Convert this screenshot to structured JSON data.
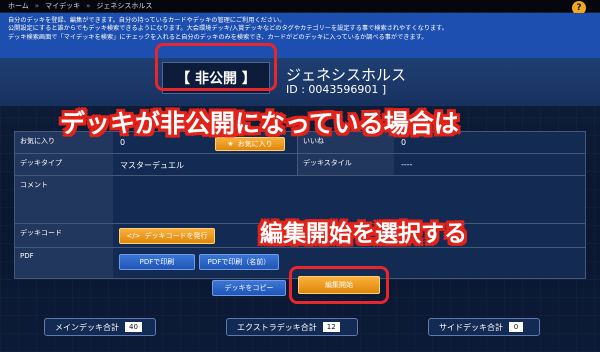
{
  "breadcrumb": [
    "ホーム",
    "マイデッキ",
    "ジェネシスホルス"
  ],
  "breadcrumb_sep": "»",
  "help_icon": "?",
  "intro_lines": [
    "自分のデッキを登録、編集ができます。自分の持っているカードやデッキの管理にご利用ください。",
    "公開設定にすると誰からでもデッキ検索できるようになります。大会環境デッキ/入賞デッキなどのタグやカテゴリーを設定する事で検索されやすくなります。",
    "デッキ検索画面で「マイデッキを検索」にチェックを入れると自分のデッキのみを検索でき、カードがどのデッキに入っているか調べる事ができます。"
  ],
  "deck": {
    "status": "【 非公開 】",
    "name": "ジェネシスホルス",
    "id_label": "ID : 0043596901 ]"
  },
  "annotations": {
    "first": "デッキが非公開になっている場合は",
    "second": "編集開始を選択する"
  },
  "details": {
    "favorite_label": "お気に入り",
    "favorite_value": "0",
    "favorite_button": "お気に入り",
    "views_label": "いいね",
    "views_value": "0",
    "type_label": "デッキタイプ",
    "type_value": "マスターデュエル",
    "style_label": "デッキスタイル",
    "style_value": "----",
    "comment_label": "コメント",
    "comment_value": "",
    "code_label": "デッキコード",
    "code_button": "デッキコードを発行",
    "pdf_label": "PDF",
    "pdf_button_1": "PDFで印刷",
    "pdf_button_2": "PDFで印刷（名前）"
  },
  "actions": {
    "copy": "デッキをコピー",
    "edit": "編集開始"
  },
  "summary": [
    {
      "label": "メインデッキ合計",
      "count": "40"
    },
    {
      "label": "エクストラデッキ合計",
      "count": "12"
    },
    {
      "label": "サイドデッキ合計",
      "count": "0"
    }
  ],
  "colors": {
    "accent_orange": "#f2a81d",
    "highlight_red": "#e8262c",
    "intro_blue": "#1d4fb0"
  }
}
